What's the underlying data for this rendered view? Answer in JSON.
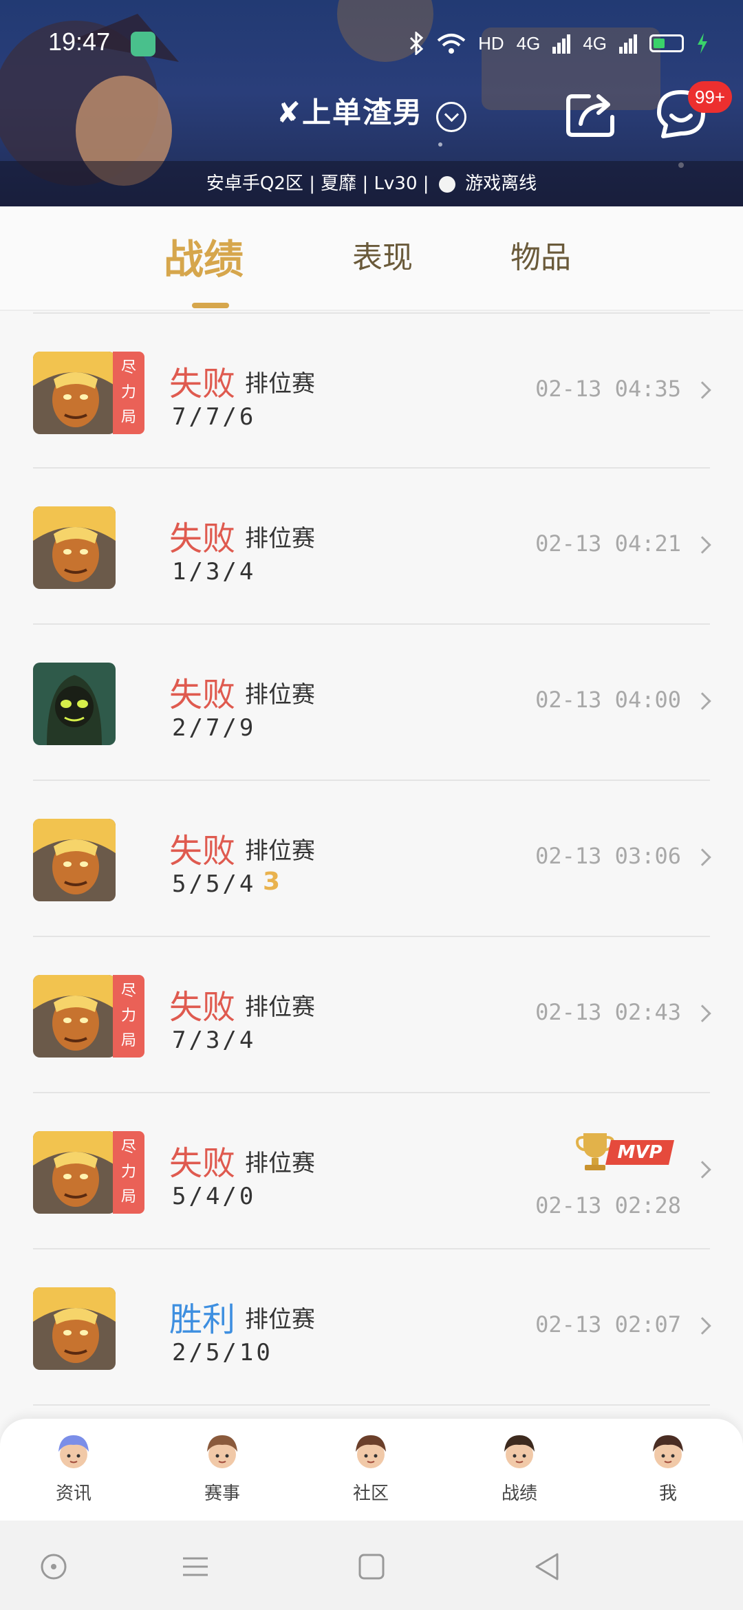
{
  "status_bar": {
    "time": "19:47",
    "network": "HD",
    "signal_1": "4G",
    "signal_2": "4G"
  },
  "header": {
    "title": "✘上单渣男",
    "subtitle_parts": [
      "安卓手Q2区",
      "夏靡",
      "Lv30"
    ],
    "online_status": "游戏离线",
    "message_badge": "99+"
  },
  "tabs": [
    {
      "label": "战绩",
      "active": true
    },
    {
      "label": "表现",
      "active": false
    },
    {
      "label": "物品",
      "active": false
    }
  ],
  "matches": [
    {
      "result": "失败",
      "result_type": "lose",
      "mode": "排位赛",
      "kda": "7/7/6",
      "time": "02-13 04:35",
      "effort_tag": "尽力局",
      "hero": "golden",
      "mvp": false,
      "multikill": ""
    },
    {
      "result": "失败",
      "result_type": "lose",
      "mode": "排位赛",
      "kda": "1/3/4",
      "time": "02-13 04:21",
      "effort_tag": "",
      "hero": "golden",
      "mvp": false,
      "multikill": ""
    },
    {
      "result": "失败",
      "result_type": "lose",
      "mode": "排位赛",
      "kda": "2/7/9",
      "time": "02-13 04:00",
      "effort_tag": "",
      "hero": "hooded",
      "mvp": false,
      "multikill": ""
    },
    {
      "result": "失败",
      "result_type": "lose",
      "mode": "排位赛",
      "kda": "5/5/4",
      "time": "02-13 03:06",
      "effort_tag": "",
      "hero": "golden",
      "mvp": false,
      "multikill": "3"
    },
    {
      "result": "失败",
      "result_type": "lose",
      "mode": "排位赛",
      "kda": "7/3/4",
      "time": "02-13 02:43",
      "effort_tag": "尽力局",
      "hero": "golden",
      "mvp": false,
      "multikill": ""
    },
    {
      "result": "失败",
      "result_type": "lose",
      "mode": "排位赛",
      "kda": "5/4/0",
      "time": "02-13 02:28",
      "effort_tag": "尽力局",
      "hero": "golden",
      "mvp": true,
      "multikill": ""
    },
    {
      "result": "胜利",
      "result_type": "win",
      "mode": "排位赛",
      "kda": "2/5/10",
      "time": "02-13 02:07",
      "effort_tag": "",
      "hero": "golden",
      "mvp": false,
      "multikill": ""
    }
  ],
  "mvp_label": "MVP",
  "bottom_nav": [
    {
      "label": "资讯",
      "icon": "news-avatar-icon",
      "color": "#7b8ee8"
    },
    {
      "label": "赛事",
      "icon": "events-avatar-icon",
      "color": "#8a5a3c"
    },
    {
      "label": "社区",
      "icon": "community-avatar-icon",
      "color": "#6b3f2a"
    },
    {
      "label": "战绩",
      "icon": "records-avatar-icon",
      "color": "#3d2a1e"
    },
    {
      "label": "我",
      "icon": "me-avatar-icon",
      "color": "#4a2d23"
    }
  ],
  "colors": {
    "accent": "#d6a64c",
    "lose": "#df5a4f",
    "win": "#3e8fe0",
    "effort_tag": "#ea6157",
    "badge": "#ec2f2f"
  }
}
